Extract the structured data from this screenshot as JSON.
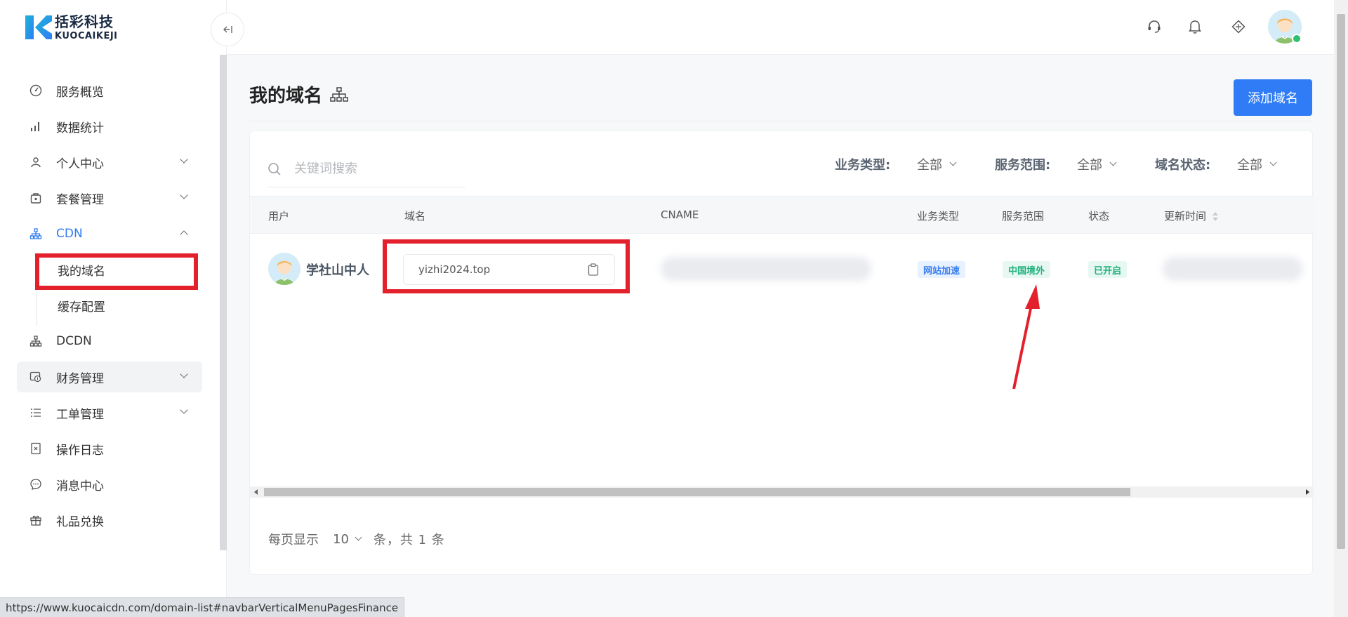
{
  "brand": {
    "name_cn": "括彩科技",
    "name_en": "KUOCAIKEJI"
  },
  "sidebar": {
    "items": [
      {
        "label": "服务概览",
        "icon": "dashboard-icon"
      },
      {
        "label": "数据统计",
        "icon": "bar-chart-icon"
      },
      {
        "label": "个人中心",
        "icon": "user-icon",
        "expandable": true
      },
      {
        "label": "套餐管理",
        "icon": "package-icon",
        "expandable": true
      },
      {
        "label": "CDN",
        "icon": "network-icon",
        "expanded": true,
        "active": true
      },
      {
        "label": "我的域名",
        "sub": true,
        "active": true
      },
      {
        "label": "缓存配置",
        "sub": true
      },
      {
        "label": "DCDN",
        "icon": "network-icon"
      },
      {
        "label": "财务管理",
        "icon": "finance-icon",
        "expandable": true,
        "hover": true
      },
      {
        "label": "工单管理",
        "icon": "list-icon",
        "expandable": true
      },
      {
        "label": "操作日志",
        "icon": "log-icon"
      },
      {
        "label": "消息中心",
        "icon": "message-icon"
      },
      {
        "label": "礼品兑换",
        "icon": "gift-icon"
      }
    ]
  },
  "page": {
    "title": "我的域名",
    "add_button": "添加域名"
  },
  "search": {
    "placeholder": "关键词搜索",
    "value": ""
  },
  "filters": [
    {
      "label": "业务类型:",
      "value": "全部"
    },
    {
      "label": "服务范围:",
      "value": "全部"
    },
    {
      "label": "域名状态:",
      "value": "全部"
    }
  ],
  "table": {
    "columns": [
      "用户",
      "域名",
      "CNAME",
      "业务类型",
      "服务范围",
      "状态",
      "更新时间"
    ],
    "rows": [
      {
        "user": "学社山中人",
        "domain": "yizhi2024.top",
        "business_type": "网站加速",
        "service_scope": "中国境外",
        "status": "已开启"
      }
    ]
  },
  "pagination": {
    "prefix": "每页显示",
    "page_size": "10",
    "total_text": "条，共 1 条"
  },
  "status_url": "https://www.kuocaicdn.com/domain-list#navbarVerticalMenuPagesFinance",
  "colors": {
    "accent": "#2f7cf6",
    "highlight": "#e3212c",
    "tag_blue": "#3a7ff0",
    "tag_green": "#22b07d"
  }
}
